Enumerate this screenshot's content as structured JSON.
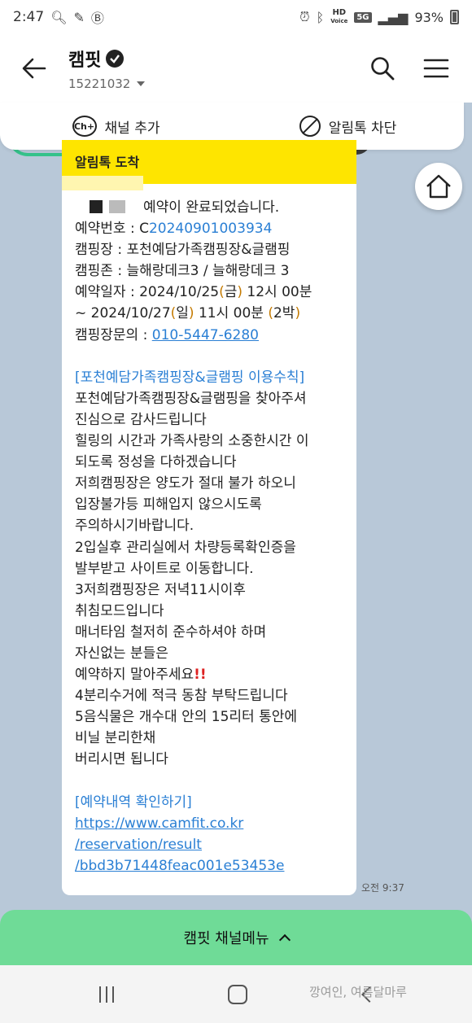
{
  "status_bar": {
    "time": "2:47",
    "hd_label": "HD",
    "voice_label": "Voice",
    "network": "5G",
    "battery": "93%"
  },
  "header": {
    "channel_name": "캠핏",
    "channel_id": "15221032"
  },
  "channel_bar": {
    "add_icon_text": "Ch+",
    "add_label": "채널 추가",
    "block_label": "알림톡 차단"
  },
  "message": {
    "banner": "알림톡 도착",
    "first_line": "예약이 완료되었습니다.",
    "reservation_label": "예약번호 : C",
    "reservation_number": "20240901003934",
    "camp_line": "캠핑장 : 포천예담가족캠핑장&글램핑",
    "zone_line": "캠핑존 : 늘해랑데크3 / 늘해랑데크 3",
    "date_line1_a": "예약일자 : 2024/10/25",
    "date_line1_open": "(",
    "date_line1_day": "금",
    "date_line1_close": ")",
    "date_line1_b": " 12시 00분",
    "date_line2_a": "~ 2024/10/27",
    "date_line2_open": "(",
    "date_line2_day": "일",
    "date_line2_close": ")",
    "date_line2_b": " 11시 00분 ",
    "date_line2_nights_open": "(",
    "date_line2_nights": "2박",
    "date_line2_nights_close": ")",
    "contact_label": "캠핑장문의 : ",
    "contact_phone": "010-5447-6280",
    "rules_title": "[포천예담가족캠핑장&글램핑 이용수칙]",
    "rules": [
      "포천예담가족캠핑장&글램핑을 찾아주셔",
      "진심으로 감사드립니다",
      "힐링의 시간과 가족사랑의 소중한시간 이",
      "되도록 정성을 다하겠습니다",
      "저희캠핑장은 양도가 절대 불가 하오니",
      "입장불가등 피해입지 않으시도록",
      "주의하시기바랍니다.",
      "2입실후 관리실에서 차량등록확인증을",
      "발부받고 사이트로 이동합니다.",
      "3저희캠핑장은 저녁11시이후",
      "취침모드입니다",
      "매너타임 철저히 준수하셔야 하며",
      "자신없는 분들은"
    ],
    "warning_line": "예약하지 말아주세요",
    "warning_mark": "!!",
    "rules_after": [
      "4분리수거에 적극 동참 부탁드립니다",
      "5음식물은 개수대 안의 15리터 통안에",
      "비닐 분리한채",
      "버리시면 됩니다"
    ],
    "link_title": "[예약내역 확인하기]",
    "link_lines": [
      "https://www.camfit.co.kr",
      "/reservation/result",
      "/bbd3b71448feac001e53453e"
    ],
    "time": "오전 9:37"
  },
  "channel_menu": {
    "label": "캠핏 채널메뉴"
  },
  "watermark": "깡여인, 여름달마루",
  "colors": {
    "banner": "#fee500",
    "link": "#2a7fd4",
    "menu": "#6fdb97",
    "chat_bg": "#b8c8d8"
  }
}
